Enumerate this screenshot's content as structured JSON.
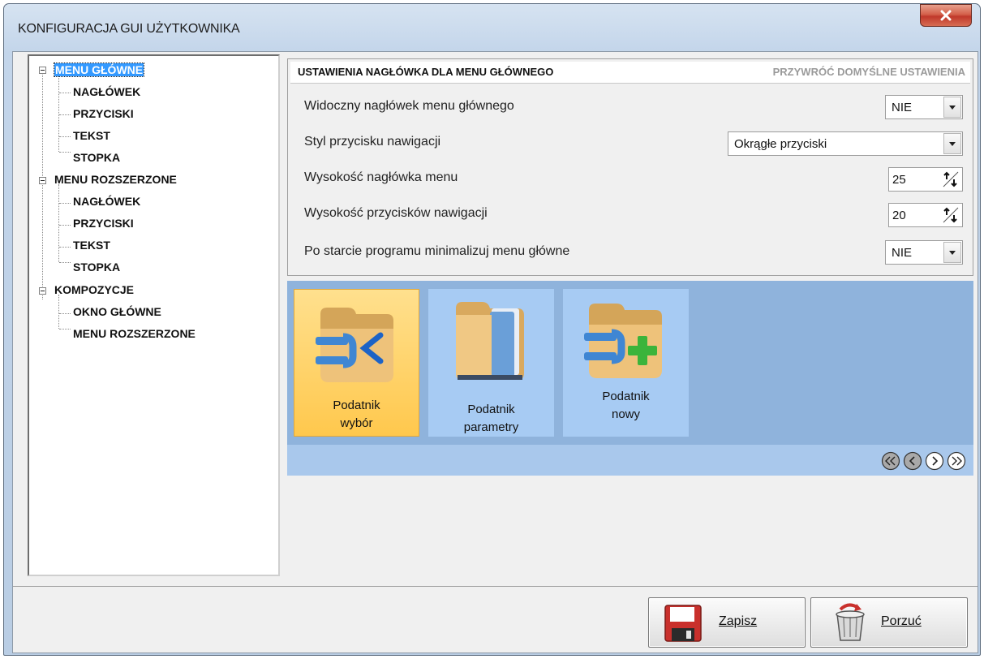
{
  "window": {
    "title": "KONFIGURACJA GUI UŻYTKOWNIKA",
    "close_label": "X"
  },
  "tree": {
    "groups": [
      {
        "label": "MENU GŁÓWNE",
        "selected": true,
        "children": [
          "NAGŁÓWEK",
          "PRZYCISKI",
          "TEKST",
          "STOPKA"
        ]
      },
      {
        "label": "MENU ROZSZERZONE",
        "selected": false,
        "children": [
          "NAGŁÓWEK",
          "PRZYCISKI",
          "TEKST",
          "STOPKA"
        ]
      },
      {
        "label": "KOMPOZYCJE",
        "selected": false,
        "children": [
          "OKNO GŁÓWNE",
          "MENU ROZSZERZONE"
        ]
      }
    ]
  },
  "settings": {
    "header_title": "USTAWIENIA NAGŁÓWKA DLA MENU GŁÓWNEGO",
    "reset_label": "PRZYWRÓĆ DOMYŚLNE USTAWIENIA",
    "rows": [
      {
        "label": "Widoczny nagłówek menu głównego",
        "value": "NIE"
      },
      {
        "label": "Styl przycisku nawigacji",
        "value": "Okrągłe przyciski"
      },
      {
        "label": "Wysokość nagłówka menu",
        "value": "25"
      },
      {
        "label": "Wysokość przycisków nawigacji",
        "value": "20"
      },
      {
        "label": "Po starcie programu minimalizuj menu główne",
        "value": "NIE"
      }
    ]
  },
  "tiles": [
    {
      "line1": "Podatnik",
      "line2": "wybór",
      "icon": "folder-back-icon"
    },
    {
      "line1": "Podatnik",
      "line2": "parametry",
      "icon": "folder-open-icon"
    },
    {
      "line1": "Podatnik",
      "line2": "nowy",
      "icon": "folder-add-icon"
    }
  ],
  "footer": {
    "save_label": "Zapisz",
    "cancel_label": "Porzuć"
  },
  "colors": {
    "selection": "#3399ff",
    "band": "#8fb3dc",
    "active_tile": "#ffc84d",
    "close": "#c0392b"
  }
}
